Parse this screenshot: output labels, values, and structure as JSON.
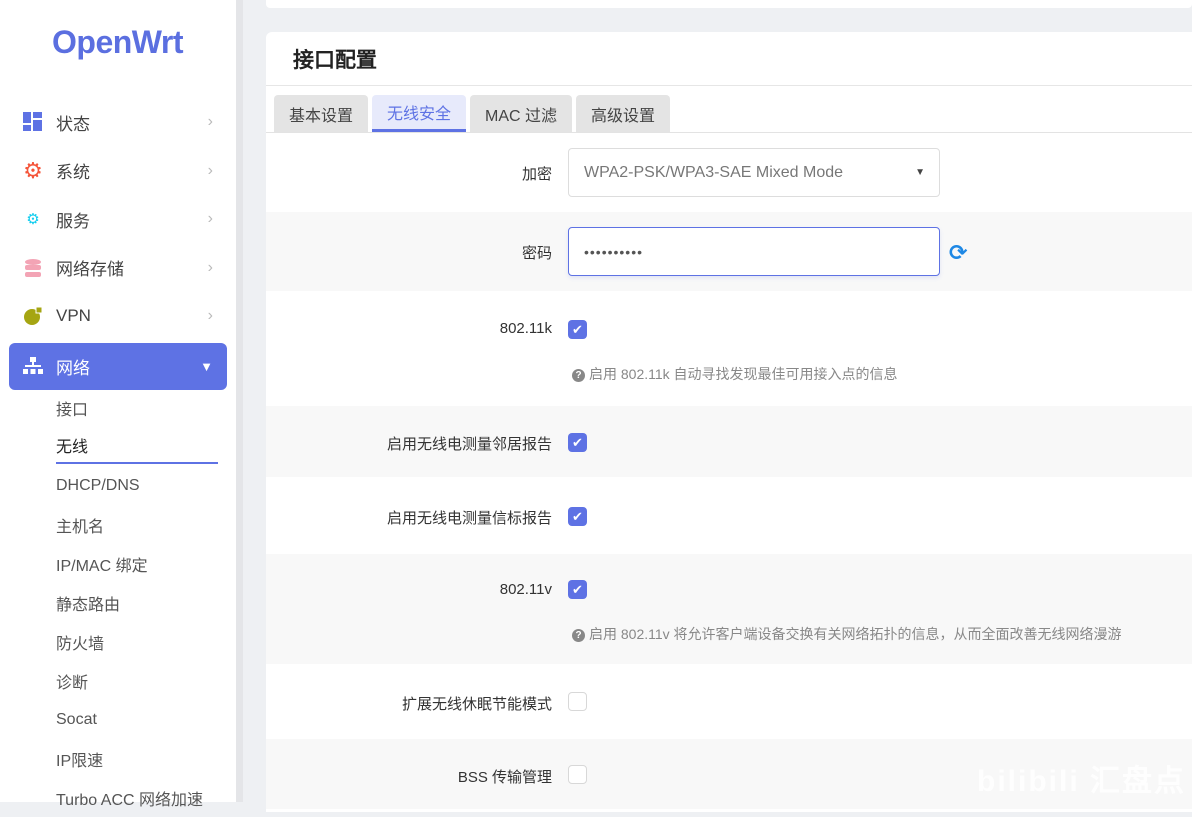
{
  "logo": "OpenWrt",
  "nav": [
    {
      "label": "状态",
      "icon": "dashboard-icon",
      "color": "#5e72e4"
    },
    {
      "label": "系统",
      "icon": "gear-icon",
      "color": "#f5553a"
    },
    {
      "label": "服务",
      "icon": "gears-icon",
      "color": "#11cdef"
    },
    {
      "label": "网络存储",
      "icon": "database-icon",
      "color": "#f3a4b5"
    },
    {
      "label": "VPN",
      "icon": "globe-lock-icon",
      "color": "#a5a512"
    },
    {
      "label": "网络",
      "icon": "sitemap-icon",
      "color": "#ffffff"
    }
  ],
  "subnav": [
    "接口",
    "无线",
    "DHCP/DNS",
    "主机名",
    "IP/MAC 绑定",
    "静态路由",
    "防火墙",
    "诊断",
    "Socat",
    "IP限速",
    "Turbo ACC 网络加速"
  ],
  "card": {
    "title": "接口配置",
    "tabs": [
      "基本设置",
      "无线安全",
      "MAC 过滤",
      "高级设置"
    ]
  },
  "form": {
    "encryption_label": "加密",
    "encryption_value": "WPA2-PSK/WPA3-SAE Mixed Mode",
    "password_label": "密码",
    "password_value": "••••••••••",
    "k_label": "802.11k",
    "k_help": "启用 802.11k 自动寻找发现最佳可用接入点的信息",
    "neighbor_label": "启用无线电测量邻居报告",
    "beacon_label": "启用无线电测量信标报告",
    "v_label": "802.11v",
    "v_help": "启用 802.11v 将允许客户端设备交换有关网络拓扑的信息，从而全面改善无线网络漫游",
    "wnm_sleep_label": "扩展无线休眠节能模式",
    "bss_label": "BSS 传输管理"
  },
  "checked": {
    "k": true,
    "neighbor": true,
    "beacon": true,
    "v": true,
    "wnm_sleep": false,
    "bss": false
  },
  "watermark": "bilibili 汇盘点"
}
